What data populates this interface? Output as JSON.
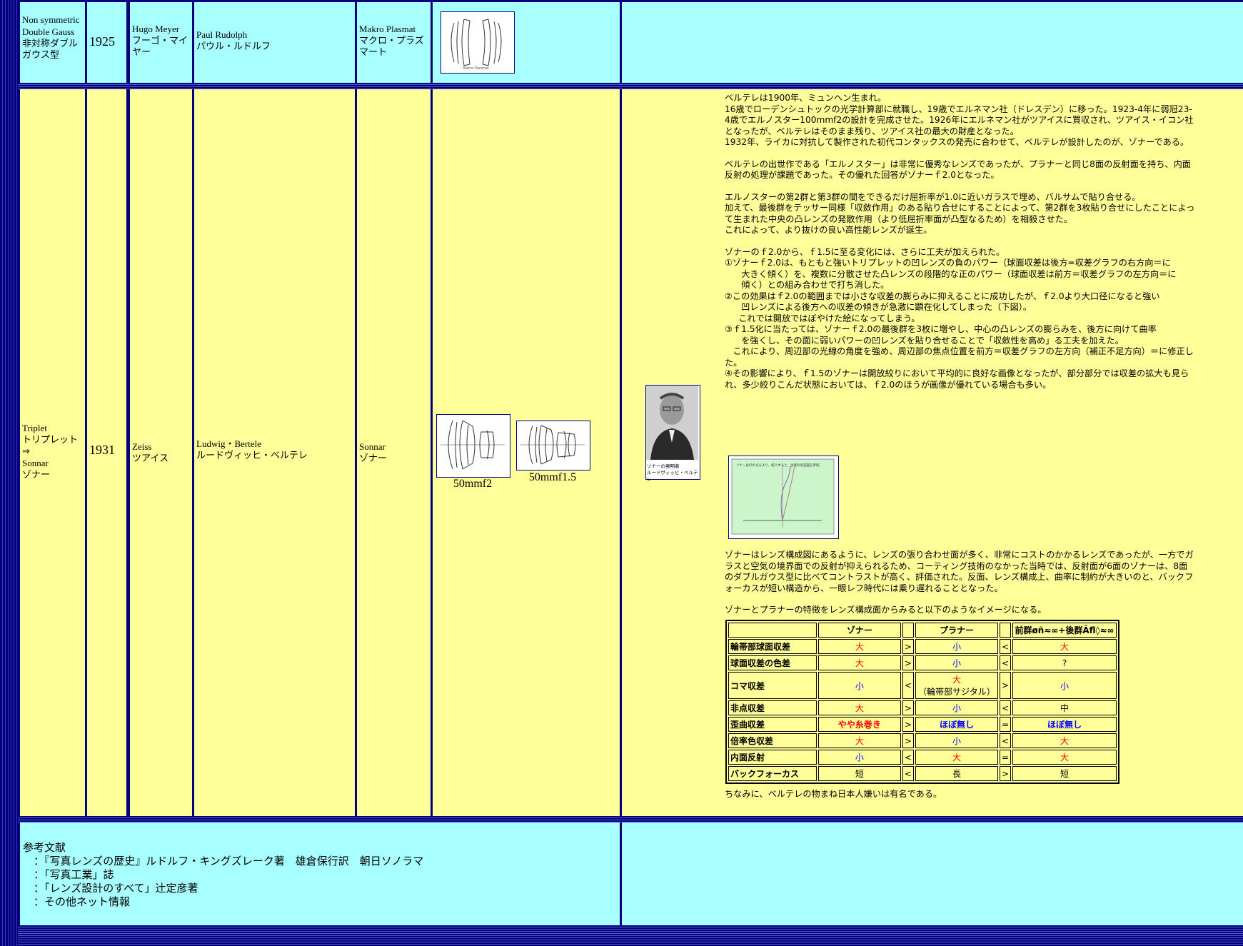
{
  "row1": {
    "type_en": "Non symmetric Double Gauss",
    "type_jp": "非対称ダブルガウス型",
    "year": "1925",
    "maker_en": "Hugo Meyer",
    "maker_jp": "フーゴ・マイヤー",
    "designer_en": "Paul Rudolph",
    "designer_jp": "パウル・ルドルフ",
    "lens_en": "Makro Plasmat",
    "lens_jp": "マクロ・プラズマート",
    "diagram_label": "Makro Plasmat"
  },
  "row2": {
    "type_en1": "Triplet",
    "type_jp1": "トリプレット",
    "arrow": "⇒",
    "type_en2": "Sonnar",
    "type_jp2": "ゾナー",
    "year": "1931",
    "maker_en": "Zeiss",
    "maker_jp": "ツアイス",
    "designer_en": "Ludwig・Bertele",
    "designer_jp": "ルードヴィッヒ・ベルテレ",
    "lens_en": "Sonnar",
    "lens_jp": "ゾナー",
    "diagram1_caption": "50mmf2",
    "diagram2_caption": "50mmf1.5",
    "portrait_caption_1": "ゾナーの発明者",
    "portrait_caption_2": "ルードヴィッヒ・ベルテレ",
    "graph_text": "ゾナーはf2のままより、絞りすると、全域の収差図を参照。"
  },
  "prose": [
    "ベルテレは1900年、ミュンヘン生まれ。",
    "16歳でローデンシュトックの光学計算部に就職し、19歳でエルネマン社（ドレスデン）に移った。1923-4年に弱冠23-4歳でエルノスター100mmf2の設計を完成させた。1926年にエルネマン社がツアイスに買収され、ツアイス・イコン社となったが、ベルテレはそのまま残り、ツアイス社の最大の財産となった。",
    "1932年、ライカに対抗して製作された初代コンタックスの発売に合わせて、ベルテレが設計したのが、ゾナーである。",
    "",
    "ベルテレの出世作である「エルノスター」は非常に優秀なレンズであったが、プラナーと同じ8面の反射面を持ち、内面反射の処理が課題であった。その優れた回答がゾナーｆ2.0となった。",
    "",
    "エルノスターの第2群と第3群の間をできるだけ屈折率が1.0に近いガラスで埋め、バルサムで貼り合せる。",
    "加えて、最後群をテッサー同様「収斂作用」のある貼り合せにすることによって、第2群を3枚貼り合せにしたことによって生まれた中央の凸レンズの発散作用（より低屈折率面が凸型なるため）を相殺させた。",
    "これによって、より抜けの良い高性能レンズが誕生。",
    "",
    "ゾナーのｆ2.0から、ｆ1.5に至る変化には、さらに工夫が加えられた。",
    "①ゾナーｆ2.0は、もともと強いトリプレットの凹レンズの負のパワー（球面収差は後方=収差グラフの右方向＝に",
    "      大きく傾く）を、複数に分散させた凸レンズの段階的な正のパワー（球面収差は前方＝収差グラフの左方向＝に",
    "      傾く）との組み合わせで打ち消した。",
    "②この効果はｆ2.0の範囲までは小さな収差の膨らみに抑えることに成功したが、ｆ2.0より大口径になると強い",
    "      凹レンズによる後方への収差の傾きが急激に顕在化してしまった（下図）。",
    "     これでは開放ではぼやけた絵になってしまう。",
    "③ｆ1.5化に当たっては、ゾナーｆ2.0の最後群を3枚に増やし、中心の凸レンズの膨らみを、後方に向けて曲率",
    "      を強くし、その面に弱いパワーの凹レンズを貼り合せることで「収斂性を高め」る工夫を加えた。",
    "   これにより、周辺部の光線の角度を強め、周辺部の焦点位置を前方＝収差グラフの左方向（補正不足方向）＝に修正した。",
    "④その影響により、ｆ1.5のゾナーは開放絞りにおいて平均的に良好な画像となったが、部分部分では収差の拡大も見られ、多少絞りこんだ状態においては、ｆ2.0のほうが画像が優れている場合も多い。"
  ],
  "prose2": [
    "ゾナーはレンズ構成図にあるように、レンズの張り合わせ面が多く、非常にコストのかかるレンズであったが、一方でガラスと空気の境界面での反射が抑えられるため、コーティング技術のなかった当時では、反射面が6面のゾナーは、8面のダブルガウス型に比べてコントラストが高く、評価された。反面、レンズ構成上、曲率に制約が大きいのと、バックフォーカスが短い構造から、一眼レフ時代には乗り遅れることとなった。",
    "",
    "ゾナーとプラナーの特徴をレンズ構成面からみると以下のようなイメージになる。"
  ],
  "table": {
    "headers": [
      "",
      "ゾナー",
      "",
      "プラナー",
      "",
      "前群øñ≈∞+後群Âfl◊≈∞"
    ],
    "rows": [
      {
        "label": "輪帯部球面収差",
        "a": "大",
        "ac": "red",
        "op1": ">",
        "b": "小",
        "bc": "blue",
        "op2": "<",
        "c": "大",
        "cc": "red"
      },
      {
        "label": "球面収差の色差",
        "a": "大",
        "ac": "red",
        "op1": ">",
        "b": "小",
        "bc": "blue",
        "op2": "<",
        "c": "?",
        "cc": "black"
      },
      {
        "label": "コマ収差",
        "a": "小",
        "ac": "blue",
        "op1": "<",
        "b": "大",
        "b2": "（輪帯部サジタル）",
        "bc": "red",
        "op2": ">",
        "c": "小",
        "cc": "blue"
      },
      {
        "label": "非点収差",
        "a": "大",
        "ac": "red",
        "op1": ">",
        "b": "小",
        "bc": "blue",
        "op2": "<",
        "c": "中",
        "cc": "black"
      },
      {
        "label": "歪曲収差",
        "a": "やや糸巻き",
        "ac": "red",
        "op1": ">",
        "b": "ほぼ無し",
        "bc": "blue",
        "op2": "=",
        "c": "ほぼ無し",
        "cc": "blue"
      },
      {
        "label": "倍率色収差",
        "a": "大",
        "ac": "red",
        "op1": ">",
        "b": "小",
        "bc": "blue",
        "op2": "<",
        "c": "大",
        "cc": "red"
      },
      {
        "label": "内面反射",
        "a": "小",
        "ac": "blue",
        "op1": "<",
        "b": "大",
        "bc": "red",
        "op2": "=",
        "c": "大",
        "cc": "red"
      },
      {
        "label": "バックフォーカス",
        "a": "短",
        "ac": "black",
        "op1": "<",
        "b": "長",
        "bc": "black",
        "op2": ">",
        "c": "短",
        "cc": "black"
      }
    ]
  },
  "closing": "ちなみに、ベルテレの物まね日本人嫌いは有名である。",
  "references": {
    "title": "参考文献",
    "items": [
      "　：『写真レンズの歴史』ルドルフ・キングズレーク著　雄倉保行訳　朝日ソノラマ",
      "　：「写真工業」誌",
      "　：「レンズ設計のすべて」辻定彦著",
      "　：その他ネット情報"
    ]
  }
}
